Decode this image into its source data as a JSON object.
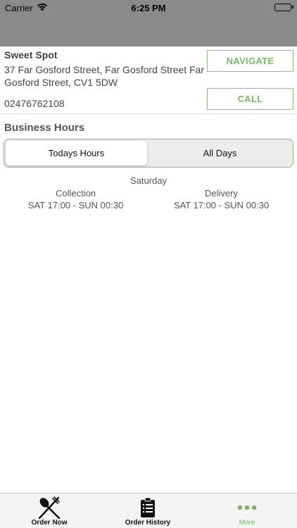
{
  "status_bar": {
    "carrier": "Carrier",
    "time": "6:25 PM",
    "wifi_icon": "wifi-icon",
    "battery_icon": "battery-icon"
  },
  "store": {
    "name": "Sweet Spot",
    "address": "37 Far Gosford Street, Far Gosford Street Far Gosford Street, CV1 5DW",
    "phone": "02476762108",
    "navigate_label": "NAVIGATE",
    "call_label": "CALL"
  },
  "business_hours": {
    "title": "Business Hours",
    "tabs": [
      {
        "label": "Todays Hours",
        "selected": true
      },
      {
        "label": "All Days",
        "selected": false
      }
    ],
    "day": "Saturday",
    "collection": {
      "label": "Collection",
      "hours": "SAT 17:00 - SUN 00:30"
    },
    "delivery": {
      "label": "Delivery",
      "hours": "SAT 17:00 - SUN 00:30"
    }
  },
  "tab_bar": {
    "items": [
      {
        "label": "Order Now",
        "icon": "utensils-icon"
      },
      {
        "label": "Order History",
        "icon": "clipboard-icon"
      },
      {
        "label": "More",
        "icon": "more-dots-icon",
        "active": true
      }
    ]
  },
  "colors": {
    "accent": "#7db36a",
    "header": "#8a8a8a"
  }
}
